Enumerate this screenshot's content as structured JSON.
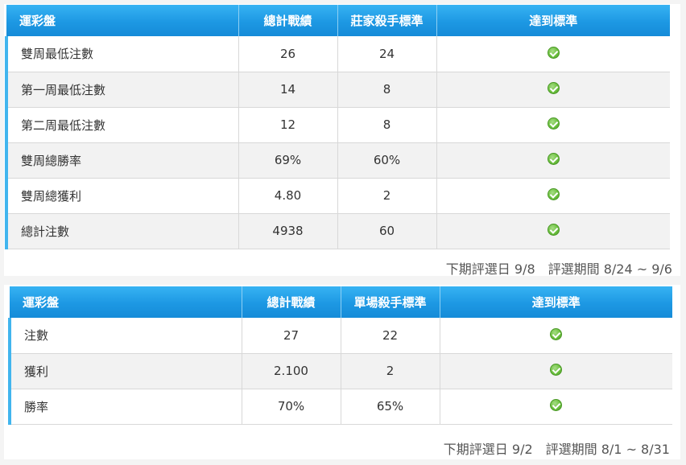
{
  "table1": {
    "headers": [
      "運彩盤",
      "總計戰績",
      "莊家殺手標準",
      "達到標準"
    ],
    "rows": [
      {
        "label": "雙周最低注數",
        "record": "26",
        "standard": "24",
        "status": "check-circle-icon"
      },
      {
        "label": "第一周最低注數",
        "record": "14",
        "standard": "8",
        "status": "check-circle-icon"
      },
      {
        "label": "第二周最低注數",
        "record": "12",
        "standard": "8",
        "status": "check-circle-icon"
      },
      {
        "label": "雙周總勝率",
        "record": "69%",
        "standard": "60%",
        "status": "check-circle-icon"
      },
      {
        "label": "雙周總獲利",
        "record": "4.80",
        "standard": "2",
        "status": "check-circle-icon"
      },
      {
        "label": "總計注數",
        "record": "4938",
        "standard": "60",
        "status": "check-circle-icon"
      }
    ],
    "next_eval": "下期評選日 9/8",
    "eval_period": "評選期間 8/24 ~ 9/6"
  },
  "table2": {
    "headers": [
      "運彩盤",
      "總計戰績",
      "單場殺手標準",
      "達到標準"
    ],
    "rows": [
      {
        "label": "注數",
        "record": "27",
        "standard": "22",
        "status": "check-circle-icon"
      },
      {
        "label": "獲利",
        "record": "2.100",
        "standard": "2",
        "status": "check-circle-icon"
      },
      {
        "label": "勝率",
        "record": "70%",
        "standard": "65%",
        "status": "check-circle-icon"
      }
    ],
    "next_eval": "下期評選日 9/2",
    "eval_period": "評選期間 8/1 ~ 8/31"
  },
  "colors": {
    "header_top": "#37b3f3",
    "header_bottom": "#158bd8",
    "accent_bar": "#41b5ee",
    "check_green": "#6cc13e",
    "row_alt": "#f2f2f2"
  }
}
